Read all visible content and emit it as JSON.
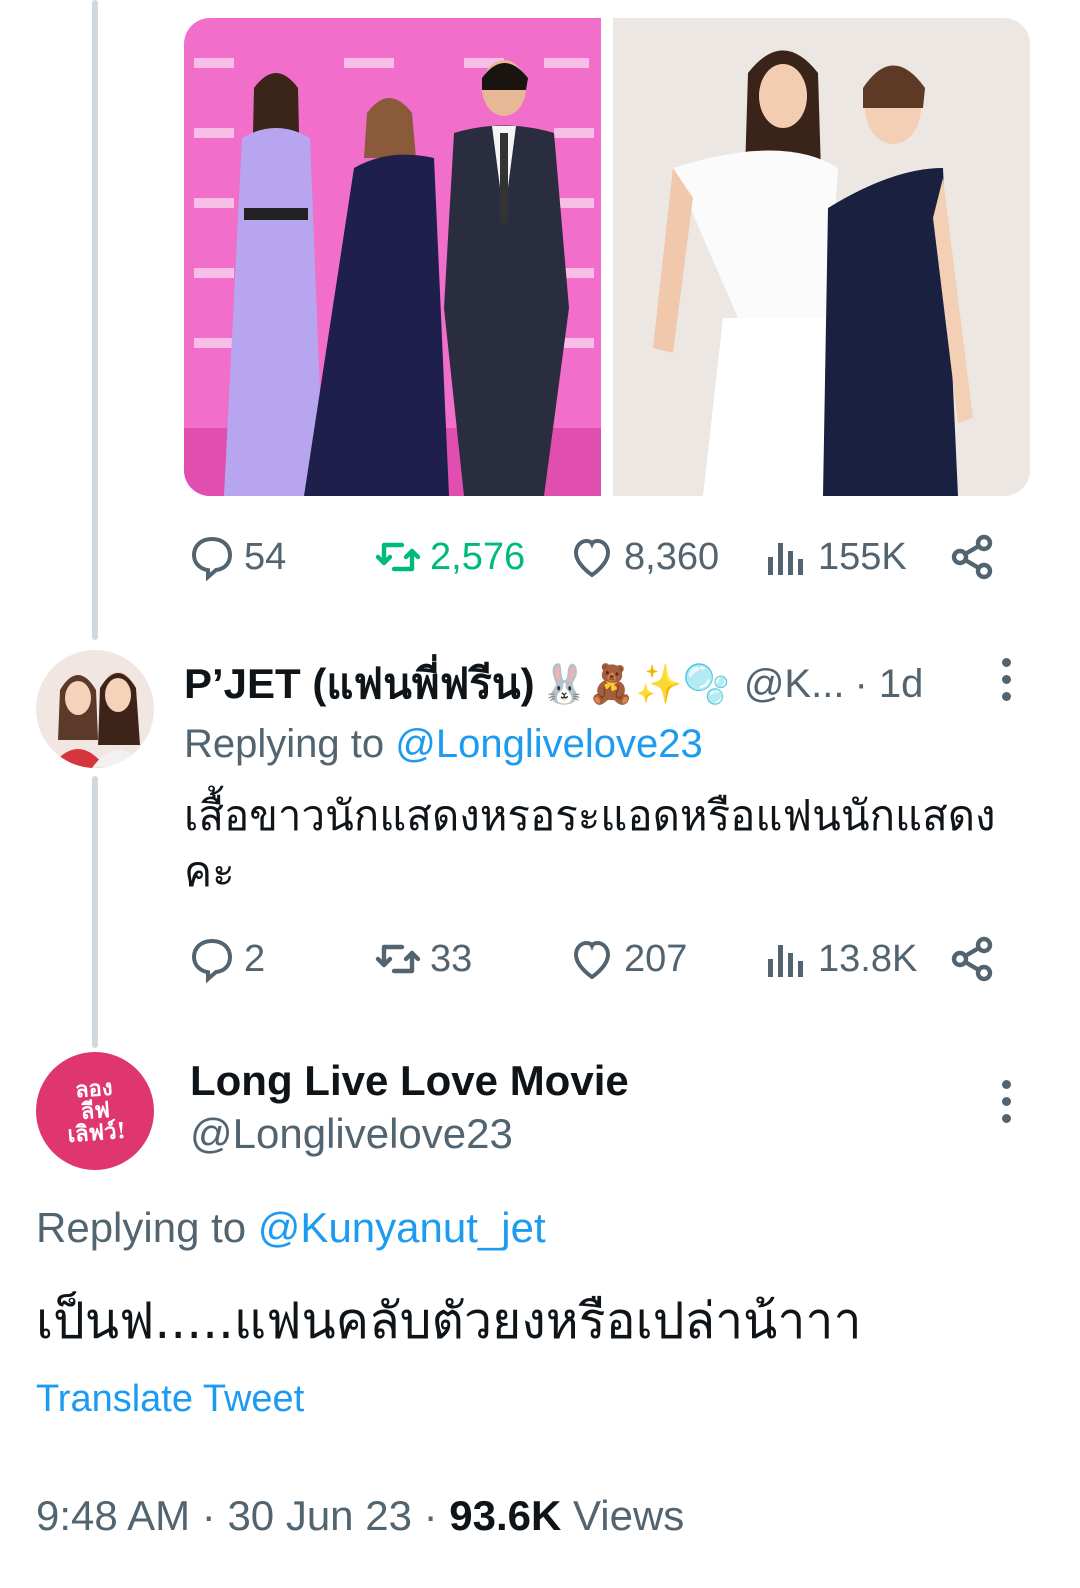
{
  "tweet_main": {
    "media": [
      {
        "icon": "premiere-photo-three-people"
      },
      {
        "icon": "photo-two-women"
      }
    ],
    "stats": {
      "replies": "54",
      "retweets": "2,576",
      "likes": "8,360",
      "views": "155K"
    }
  },
  "reply_1": {
    "display_name": "P’JET (แฟนพี่ฟรีน)",
    "emojis": "🐰🧸✨🫧",
    "handle": "@K...",
    "time": "· 1d",
    "replying_prefix": "Replying to",
    "replying_to": "@Longlivelove23",
    "text": "เสื้อขาวนักแสดงหรอระแอดหรือแฟนนักแสดงคะ",
    "stats": {
      "replies": "2",
      "retweets": "33",
      "likes": "207",
      "views": "13.8K"
    }
  },
  "focused_tweet": {
    "display_name": "Long Live Love Movie",
    "handle": "@Longlivelove23",
    "avatar_text": "ลอง\nลีฟ\nเลิฟว์!",
    "replying_prefix": "Replying to",
    "replying_to": "@Kunyanut_jet",
    "text": "เป็นฟ.....แฟนคลับตัวยงหรือเปล่าน้าาา",
    "translate_label": "Translate Tweet",
    "time": "9:48 AM",
    "date": "30 Jun 23",
    "views_count": "93.6K",
    "views_label": "Views"
  },
  "colors": {
    "accent": "#1d9bf0",
    "retweet_green": "#00ba7c",
    "secondary_text": "#536471",
    "avatar_pink": "#e0366f"
  }
}
